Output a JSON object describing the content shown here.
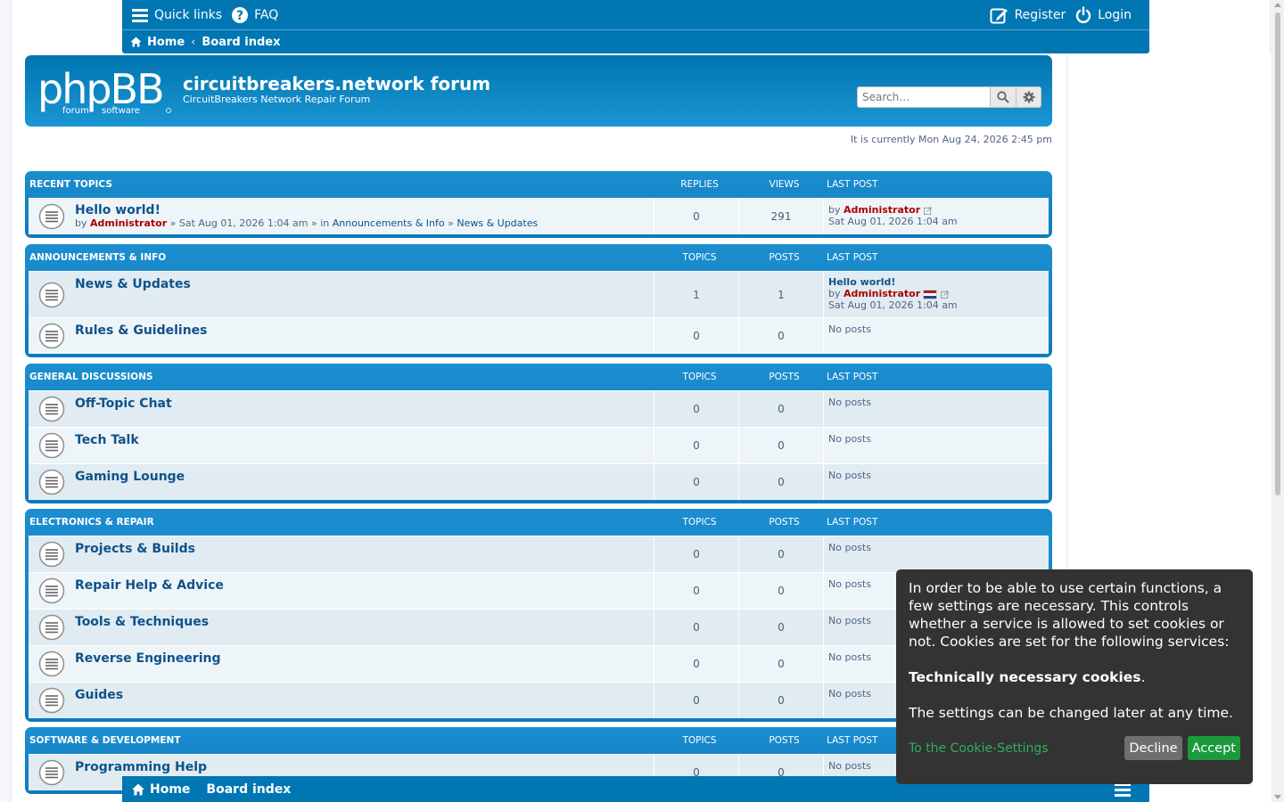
{
  "topnav": {
    "quick_links": "Quick links",
    "faq": "FAQ",
    "register": "Register",
    "login": "Login",
    "home": "Home",
    "board_index": "Board index"
  },
  "header": {
    "site_title": "circuitbreakers.network forum",
    "site_desc": "CircuitBreakers Network Repair Forum",
    "search_placeholder": "Search…",
    "logo_text": "phpBB",
    "logo_sub1": "forum",
    "logo_sub2": "software"
  },
  "timestamp": "It is currently Mon Aug 24, 2026 2:45 pm",
  "recent": {
    "title": "RECENT TOPICS",
    "col1": "REPLIES",
    "col2": "VIEWS",
    "col3": "LAST POST",
    "row": {
      "name": "Hello world!",
      "by": "by",
      "author": "Administrator",
      "date_sep": "» Sat Aug 01, 2026 1:04 am » in",
      "forum1": "Announcements & Info",
      "sep": "»",
      "forum2": "News & Updates",
      "replies": "0",
      "views": "291",
      "lp_by": "by",
      "lp_author": "Administrator",
      "lp_date": "Sat Aug 01, 2026 1:04 am"
    }
  },
  "announcements": {
    "title": "ANNOUNCEMENTS & INFO",
    "col1": "TOPICS",
    "col2": "POSTS",
    "col3": "LAST POST",
    "news": {
      "name": "News & Updates",
      "topics": "1",
      "posts": "1",
      "lp_title": "Hello world!",
      "lp_by": "by",
      "lp_author": "Administrator",
      "lp_date": "Sat Aug 01, 2026 1:04 am"
    },
    "rules": {
      "name": "Rules & Guidelines",
      "topics": "0",
      "posts": "0",
      "lp": "No posts"
    }
  },
  "general": {
    "title": "GENERAL DISCUSSIONS",
    "col1": "TOPICS",
    "col2": "POSTS",
    "col3": "LAST POST",
    "forums": [
      {
        "name": "Off-Topic Chat",
        "topics": "0",
        "posts": "0",
        "lp": "No posts"
      },
      {
        "name": "Tech Talk",
        "topics": "0",
        "posts": "0",
        "lp": "No posts"
      },
      {
        "name": "Gaming Lounge",
        "topics": "0",
        "posts": "0",
        "lp": "No posts"
      }
    ]
  },
  "electronics": {
    "title": "ELECTRONICS & REPAIR",
    "col1": "TOPICS",
    "col2": "POSTS",
    "col3": "LAST POST",
    "forums": [
      {
        "name": "Projects & Builds",
        "topics": "0",
        "posts": "0",
        "lp": "No posts"
      },
      {
        "name": "Repair Help & Advice",
        "topics": "0",
        "posts": "0",
        "lp": "No posts"
      },
      {
        "name": "Tools & Techniques",
        "topics": "0",
        "posts": "0",
        "lp": "No posts"
      },
      {
        "name": "Reverse Engineering",
        "topics": "0",
        "posts": "0",
        "lp": "No posts"
      },
      {
        "name": "Guides",
        "topics": "0",
        "posts": "0",
        "lp": "No posts"
      }
    ]
  },
  "software": {
    "title": "SOFTWARE & DEVELOPMENT",
    "col1": "TOPICS",
    "col2": "POSTS",
    "col3": "LAST POST",
    "forums": [
      {
        "name": "Programming Help",
        "topics": "0",
        "posts": "0",
        "lp": "No posts"
      }
    ]
  },
  "bottomnav": {
    "home": "Home",
    "board_index": "Board index"
  },
  "cookie": {
    "text": "In order to be able to use certain functions, a few settings are necessary. This controls whether a service is allowed to set cookies or not. Cookies are set for the following services:",
    "bold": "Technically necessary cookies",
    "dot": ".",
    "later": "The settings can be changed later at any time.",
    "settings_link": "To the Cookie-Settings",
    "decline": "Decline",
    "accept": "Accept"
  },
  "colors": {
    "nav_blue": "#0076b3",
    "link": "#105289",
    "admin_red": "#aa0000",
    "accept_green": "#1a9a3c"
  }
}
